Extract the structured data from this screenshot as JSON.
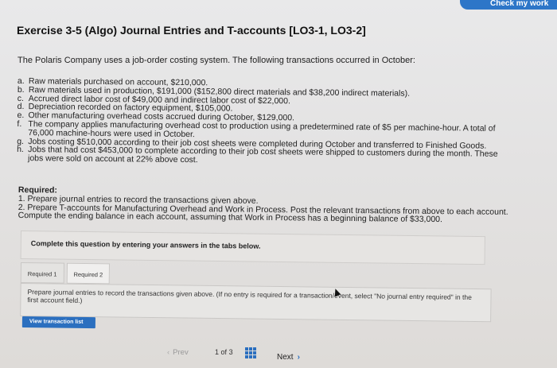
{
  "header": {
    "check_button": "Check my work"
  },
  "exercise": {
    "title": "Exercise 3-5 (Algo) Journal Entries and T-accounts [LO3-1, LO3-2]",
    "intro": "The Polaris Company uses a job-order costing system. The following transactions occurred in October:"
  },
  "transactions": [
    {
      "letter": "a.",
      "text": "Raw materials purchased on account, $210,000."
    },
    {
      "letter": "b.",
      "text": "Raw materials used in production, $191,000 ($152,800 direct materials and $38,200 indirect materials)."
    },
    {
      "letter": "c.",
      "text": "Accrued direct labor cost of $49,000 and indirect labor cost of $22,000."
    },
    {
      "letter": "d.",
      "text": "Depreciation recorded on factory equipment, $105,000."
    },
    {
      "letter": "e.",
      "text": "Other manufacturing overhead costs accrued during October, $129,000."
    },
    {
      "letter": "f.",
      "text": "The company applies manufacturing overhead cost to production using a predetermined rate of $5 per machine-hour. A total of 76,000 machine-hours were used in October."
    },
    {
      "letter": "g.",
      "text": "Jobs costing $510,000 according to their job cost sheets were completed during October and transferred to Finished Goods."
    },
    {
      "letter": "h.",
      "text": "Jobs that had cost $453,000 to complete according to their job cost sheets were shipped to customers during the month. These jobs were sold on account at 22% above cost."
    }
  ],
  "required": {
    "heading": "Required:",
    "item1": "1. Prepare journal entries to record the transactions given above.",
    "item2": "2. Prepare T-accounts for Manufacturing Overhead and Work in Process. Post the relevant transactions from above to each account. Compute the ending balance in each account, assuming that Work in Process has a beginning balance of $33,000."
  },
  "instruction_bar": "Complete this question by entering your answers in the tabs below.",
  "tabs": [
    {
      "label": "Required 1"
    },
    {
      "label": "Required 2"
    }
  ],
  "tab_content": "Prepare journal entries to record the transactions given above. (If no entry is required for a transaction/event, select \"No journal entry required\" in the first account field.)",
  "view_transaction_list": "View transaction list",
  "pager": {
    "prev": "Prev",
    "current": "1",
    "of": "of",
    "total": "3",
    "next": "Next"
  }
}
